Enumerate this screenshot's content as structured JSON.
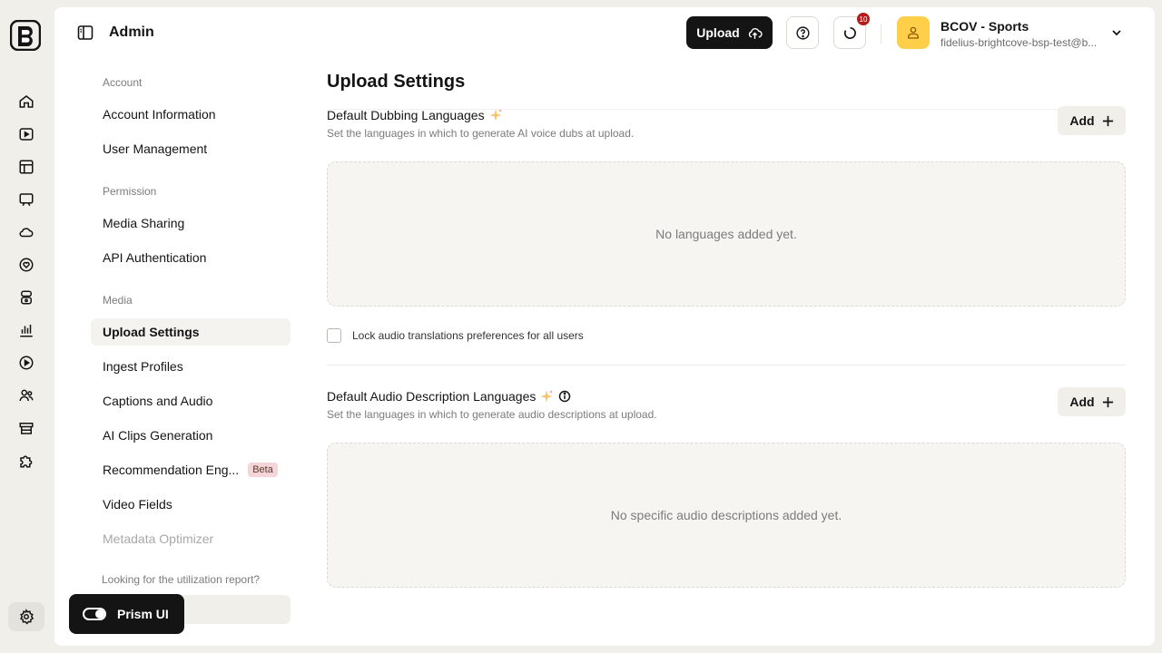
{
  "header": {
    "title": "Admin",
    "upload_label": "Upload",
    "notification_count": "10"
  },
  "account": {
    "name": "BCOV - Sports",
    "email": "fidelius-brightcove-bsp-test@b..."
  },
  "rail": {
    "icons": [
      "home-icon",
      "video-icon",
      "layout-icon",
      "screen-icon",
      "cloud-icon",
      "heart-badge-icon",
      "clips-icon",
      "analytics-icon",
      "play-circle-icon",
      "users-icon",
      "store-icon",
      "puzzle-icon",
      "gear-icon"
    ]
  },
  "subnav": {
    "group_account": "Account",
    "account_information": "Account Information",
    "user_management": "User Management",
    "group_permission": "Permission",
    "media_sharing": "Media Sharing",
    "api_authentication": "API Authentication",
    "group_media": "Media",
    "upload_settings": "Upload Settings",
    "ingest_profiles": "Ingest Profiles",
    "captions_audio": "Captions and Audio",
    "ai_clips": "AI Clips Generation",
    "recommendation": "Recommendation Eng...",
    "beta_badge": "Beta",
    "video_fields": "Video Fields",
    "metadata_optimizer": "Metadata Optimizer",
    "utilization_question": "Looking for the utilization report?"
  },
  "content": {
    "page_title": "Upload Settings",
    "dubbing": {
      "title": "Default Dubbing Languages",
      "description": "Set the languages in which to generate AI voice dubs at upload.",
      "add_label": "Add",
      "empty_text": "No languages added yet."
    },
    "lock_label": "Lock audio translations preferences for all users",
    "audio_desc": {
      "title": "Default Audio Description Languages",
      "description": "Set the languages in which to generate audio descriptions at upload.",
      "add_label": "Add",
      "empty_text": "No specific audio descriptions added yet."
    }
  },
  "prism": {
    "label": "Prism UI"
  },
  "colors": {
    "accent_dark": "#141414",
    "avatar_yellow": "#ffcf4a",
    "badge_red": "#b71c1c",
    "beta_pink": "#f6d5da"
  }
}
